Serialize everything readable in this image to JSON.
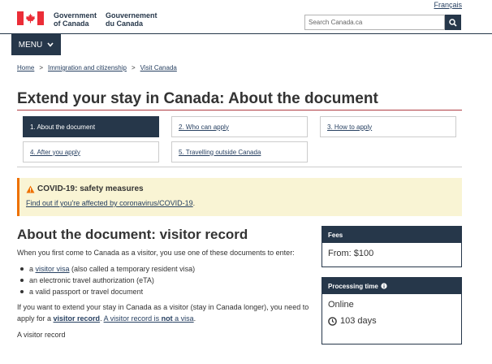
{
  "header": {
    "language_link": "Français",
    "sig_en_line1": "Government",
    "sig_en_line2": "of Canada",
    "sig_fr_line1": "Gouvernement",
    "sig_fr_line2": "du Canada",
    "search_placeholder": "Search Canada.ca",
    "menu_label": "MENU"
  },
  "breadcrumb": [
    "Home",
    "Immigration and citizenship",
    "Visit Canada"
  ],
  "page_title": "Extend your stay in Canada: About the document",
  "steps": [
    {
      "label": "1. About the document",
      "active": true
    },
    {
      "label": "2. Who can apply",
      "active": false
    },
    {
      "label": "3. How to apply",
      "active": false
    },
    {
      "label": "4. After you apply",
      "active": false
    },
    {
      "label": "5. Travelling outside Canada",
      "active": false
    }
  ],
  "alert": {
    "title": "COVID-19: safety measures",
    "link": "Find out if you're affected by coronavirus/COVID-19",
    "link_suffix": "."
  },
  "section": {
    "title": "About the document: visitor record",
    "intro": "When you first come to Canada as a visitor, you use one of these documents to enter:",
    "bullet1_prefix": "a ",
    "bullet1_link": "visitor visa",
    "bullet1_suffix": " (also called a temporary resident visa)",
    "bullet2": "an electronic travel authorization (eTA)",
    "bullet3": "a valid passport or travel document",
    "extend_text": "If you want to extend your stay in Canada as a visitor (stay in Canada longer), you need to apply for a ",
    "extend_link": "visitor record",
    "extend_mid": ". ",
    "extend_link2_a": "A visitor record is ",
    "extend_link2_b": "not",
    "extend_link2_c": " a visa",
    "extend_end": ".",
    "figure_caption": "A visitor record"
  },
  "fees_panel": {
    "heading": "Fees",
    "value": "From: $100"
  },
  "processing_panel": {
    "heading": "Processing time",
    "mode": "Online",
    "time": "103 days"
  },
  "colors": {
    "brand_dark": "#26374a",
    "flag_red": "#eb2d37",
    "alert_bg": "#f9f4d4",
    "title_rule": "#af3c43"
  }
}
